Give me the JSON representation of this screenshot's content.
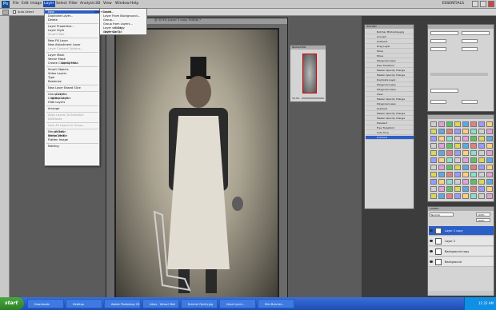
{
  "menubar": {
    "items": [
      "File",
      "Edit",
      "Image",
      "Layer",
      "Select",
      "Filter",
      "Analysis",
      "3D",
      "View",
      "Window",
      "Help"
    ],
    "workspace": "ESSENTIALS"
  },
  "options": {
    "auto_select": "Auto-Select"
  },
  "document": {
    "title": "@ 33.3% (Layer 2 copy, RGB/8) *"
  },
  "layer_menu": {
    "items": [
      {
        "label": "New",
        "sc": "",
        "hl": true
      },
      {
        "label": "Duplicate Layer...",
        "sc": ""
      },
      {
        "label": "Delete",
        "sc": ""
      },
      {
        "sep": true
      },
      {
        "label": "Layer Properties...",
        "sc": ""
      },
      {
        "label": "Layer Style",
        "sc": ""
      },
      {
        "label": "Smart Filter",
        "sc": "",
        "dis": true
      },
      {
        "sep": true
      },
      {
        "label": "New Fill Layer",
        "sc": ""
      },
      {
        "label": "New Adjustment Layer",
        "sc": ""
      },
      {
        "label": "Layer Content Options...",
        "sc": "",
        "dis": true
      },
      {
        "sep": true
      },
      {
        "label": "Layer Mask",
        "sc": ""
      },
      {
        "label": "Vector Mask",
        "sc": ""
      },
      {
        "label": "Create Clipping Mask",
        "sc": "Alt+Ctrl+G"
      },
      {
        "sep": true
      },
      {
        "label": "Smart Objects",
        "sc": ""
      },
      {
        "label": "Video Layers",
        "sc": ""
      },
      {
        "label": "Type",
        "sc": ""
      },
      {
        "label": "Rasterize",
        "sc": ""
      },
      {
        "sep": true
      },
      {
        "label": "New Layer Based Slice",
        "sc": ""
      },
      {
        "sep": true
      },
      {
        "label": "Group Layers",
        "sc": "Ctrl+G"
      },
      {
        "label": "Ungroup Layers",
        "sc": "Shift+Ctrl+G"
      },
      {
        "label": "Hide Layers",
        "sc": ""
      },
      {
        "sep": true
      },
      {
        "label": "Arrange",
        "sc": ""
      },
      {
        "sep": true
      },
      {
        "label": "Align Layers To Selection",
        "sc": "",
        "dis": true
      },
      {
        "label": "Distribute",
        "sc": "",
        "dis": true
      },
      {
        "sep": true
      },
      {
        "label": "Lock All Layers in Group...",
        "sc": "",
        "dis": true
      },
      {
        "sep": true
      },
      {
        "label": "Merge Down",
        "sc": "Ctrl+E"
      },
      {
        "label": "Merge Visible",
        "sc": "Shift+Ctrl+E"
      },
      {
        "label": "Flatten Image",
        "sc": ""
      },
      {
        "sep": true
      },
      {
        "label": "Matting",
        "sc": ""
      }
    ]
  },
  "new_submenu": {
    "items": [
      {
        "label": "Layer...",
        "sc": "Shift+Ctrl+N"
      },
      {
        "label": "Layer From Background...",
        "sc": ""
      },
      {
        "label": "Group...",
        "sc": ""
      },
      {
        "label": "Group from Layers...",
        "sc": ""
      },
      {
        "label": "Layer via Copy",
        "sc": "Ctrl+J"
      },
      {
        "label": "Layer via Cut",
        "sc": "Shift+Ctrl+J"
      }
    ]
  },
  "navigator": {
    "title": "NAVIGATOR",
    "zoom": "33.3%"
  },
  "history": {
    "title": "HISTORY",
    "rows": [
      "Butcher Photoshop.jpg",
      "Convert",
      "Gradient",
      "Drag Layer",
      "Move",
      "Move",
      "Polygonal Lasso",
      "Free Transform",
      "Master Opacity Change",
      "Master Opacity Change",
      "Duplicate Layer",
      "Polygonal Lasso",
      "Polygonal Lasso",
      "Clear",
      "Master Opacity Change",
      "Polygonal Lasso",
      "Gradient",
      "Master Opacity Change",
      "Master Opacity Change",
      "Deselect",
      "Free Transform",
      "Auto Tone",
      "Gradient"
    ],
    "selected": 22
  },
  "layers": {
    "title": "LAYERS",
    "blend": "Normal",
    "opacity": "100%",
    "fill": "100%",
    "rows": [
      {
        "name": "Layer 2 copy",
        "sel": true
      },
      {
        "name": "Layer 2",
        "sel": false
      },
      {
        "name": "Background copy",
        "sel": false
      },
      {
        "name": "Background",
        "sel": false
      }
    ]
  },
  "taskbar": {
    "start": "start",
    "tasks": [
      "Downloads",
      "Desktop",
      "Adobe Photoshop CS...",
      "Inbox - Yahoo! Mail",
      "Butcher Family.jpg",
      "Heart Lynch...",
      "Mini Butcher..."
    ],
    "clock": "11:22 AM"
  },
  "colors": {
    "accent": "#2a5fc9",
    "taskbar": "#245edb"
  }
}
